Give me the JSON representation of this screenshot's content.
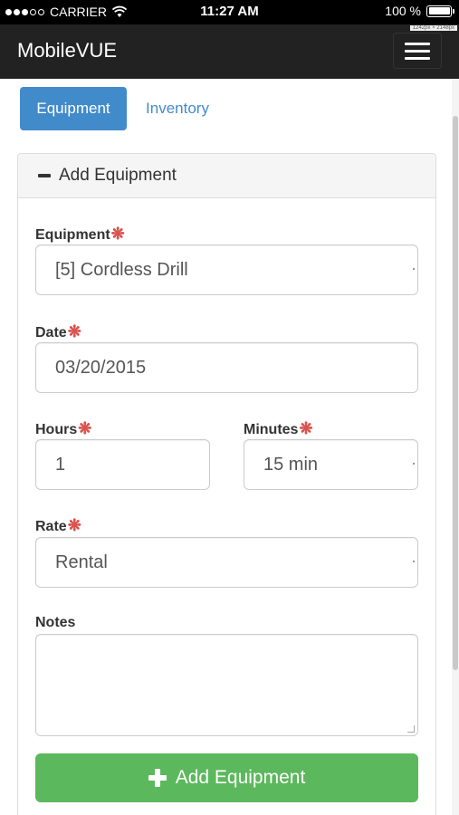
{
  "status_bar": {
    "carrier": "CARRIER",
    "time": "11:27 AM",
    "battery": "100 %"
  },
  "navbar": {
    "brand": "MobileVUE",
    "dims_tag": "1242px × 2148px",
    "menu_icon": "hamburger-icon"
  },
  "tabs": [
    {
      "label": "Equipment",
      "active": true
    },
    {
      "label": "Inventory",
      "active": false
    }
  ],
  "panel": {
    "heading": "Add Equipment",
    "heading_icon": "minus-icon"
  },
  "form": {
    "equipment": {
      "label": "Equipment",
      "required_mark": "❋",
      "value": "[5] Cordless Drill"
    },
    "date": {
      "label": "Date",
      "required_mark": "❋",
      "value": "03/20/2015"
    },
    "hours": {
      "label": "Hours",
      "required_mark": "❋",
      "value": "1"
    },
    "minutes": {
      "label": "Minutes",
      "required_mark": "❋",
      "value": "15 min"
    },
    "rate": {
      "label": "Rate",
      "required_mark": "❋",
      "value": "Rental"
    },
    "notes": {
      "label": "Notes",
      "value": ""
    }
  },
  "submit": {
    "label": "Add Equipment",
    "icon": "plus-icon"
  },
  "colors": {
    "primary": "#428bca",
    "success": "#5cb85c",
    "required": "#d9534f",
    "navbar": "#222222"
  }
}
